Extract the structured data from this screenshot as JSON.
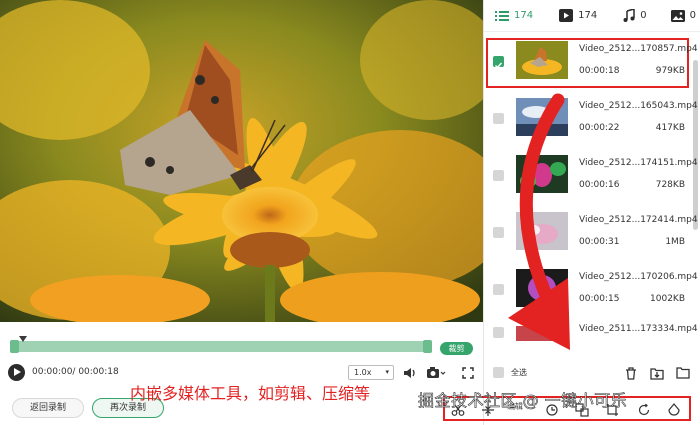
{
  "tabs": [
    {
      "icon": "list-icon",
      "count": "174"
    },
    {
      "icon": "video-icon",
      "count": "174"
    },
    {
      "icon": "music-icon",
      "count": "0"
    },
    {
      "icon": "image-icon",
      "count": "0"
    }
  ],
  "files": [
    {
      "name": "Video_2512...170857.mp4",
      "duration": "00:00:18",
      "size": "979KB",
      "checked": true
    },
    {
      "name": "Video_2512...165043.mp4",
      "duration": "00:00:22",
      "size": "417KB",
      "checked": false
    },
    {
      "name": "Video_2512...174151.mp4",
      "duration": "00:00:16",
      "size": "728KB",
      "checked": false
    },
    {
      "name": "Video_2512...172414.mp4",
      "duration": "00:00:31",
      "size": "1MB",
      "checked": false
    },
    {
      "name": "Video_2512...170206.mp4",
      "duration": "00:00:15",
      "size": "1002KB",
      "checked": false
    },
    {
      "name": "Video_2511...173334.mp4",
      "duration": "",
      "size": "",
      "checked": false
    }
  ],
  "select_all": "全选",
  "player": {
    "time": "00:00:00/ 00:00:18",
    "speed": "1.0x",
    "cut_label": "裁剪"
  },
  "buttons": {
    "back_record": "返回录制",
    "record_again": "再次录制"
  },
  "toolbar": {
    "edit_label": "编辑"
  },
  "annotation": "内嵌多媒体工具，如剪辑、压缩等",
  "watermark": "掘金技术社区 @ 一键小可乐",
  "colors": {
    "accent": "#35a56c",
    "highlight": "#e32222"
  }
}
